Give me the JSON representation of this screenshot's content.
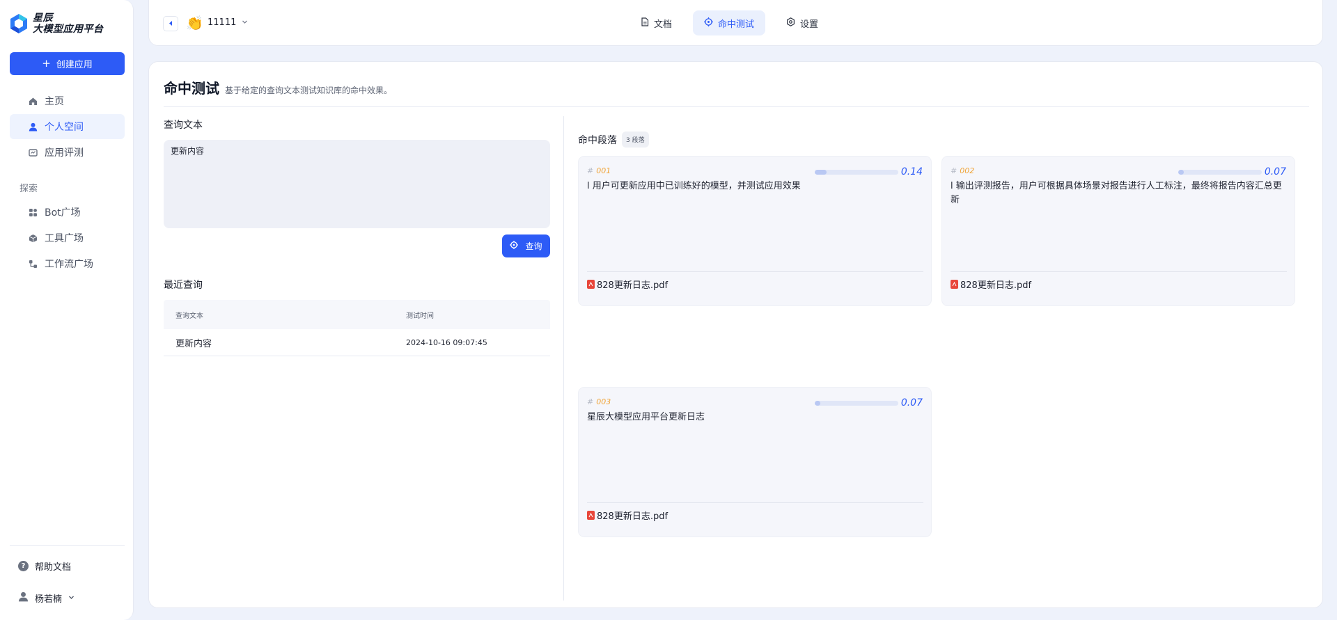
{
  "sidebar": {
    "logo_line1": "星辰",
    "logo_line2": "大模型应用平台",
    "create_label": "创建应用",
    "nav": [
      {
        "label": "主页",
        "icon": "home-icon"
      },
      {
        "label": "个人空间",
        "icon": "user-icon"
      },
      {
        "label": "应用评测",
        "icon": "evaluation-icon"
      }
    ],
    "explore_label": "探索",
    "explore": [
      {
        "label": "Bot广场",
        "icon": "grid-icon"
      },
      {
        "label": "工具广场",
        "icon": "cube-icon"
      },
      {
        "label": "工作流广场",
        "icon": "workflow-icon"
      }
    ],
    "help_label": "帮助文档",
    "user_name": "杨若楠"
  },
  "topbar": {
    "app_emoji": "👏",
    "app_name": "11111",
    "tabs": [
      {
        "label": "文档",
        "icon": "document-icon"
      },
      {
        "label": "命中测试",
        "icon": "target-icon"
      },
      {
        "label": "设置",
        "icon": "gear-icon"
      }
    ],
    "active_tab": "命中测试"
  },
  "page": {
    "title": "命中测试",
    "subtitle": "基于给定的查询文本测试知识库的命中效果。",
    "query_label": "查询文本",
    "query_value": "更新内容",
    "query_button": "查询",
    "recent_label": "最近查询",
    "recent_headers": [
      "查询文本",
      "测试时间"
    ],
    "recent_rows": [
      {
        "text": "更新内容",
        "time": "2024-10-16 09:07:45"
      }
    ],
    "hits_label": "命中段落",
    "hits_badge": "3 段落",
    "hits": [
      {
        "no": "001",
        "score": "0.14",
        "score_value": 0.14,
        "text": "l 用户可更新应用中已训练好的模型，并测试应用效果",
        "file": "828更新日志.pdf"
      },
      {
        "no": "002",
        "score": "0.07",
        "score_value": 0.07,
        "text": "l 输出评测报告，用户可根据具体场景对报告进行人工标注，最终将报告内容汇总更新",
        "file": "828更新日志.pdf"
      },
      {
        "no": "003",
        "score": "0.07",
        "score_value": 0.07,
        "text": "星辰大模型应用平台更新日志",
        "file": "828更新日志.pdf"
      }
    ]
  },
  "colors": {
    "accent": "#2d5bf6",
    "hit_number": "#f0a437",
    "pdf": "#e8463a"
  }
}
